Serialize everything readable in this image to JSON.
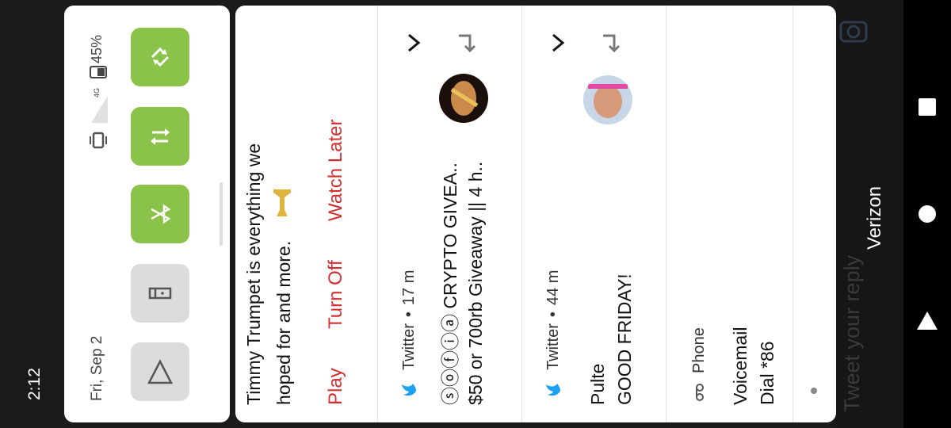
{
  "status_bar": {
    "time": "2:12"
  },
  "quick_settings": {
    "date": "Fri, Sep 2",
    "network": "4G",
    "battery_percent": "45%",
    "tiles": [
      {
        "name": "auto-rotate",
        "state": "on"
      },
      {
        "name": "mobile-data",
        "state": "on"
      },
      {
        "name": "bluetooth",
        "state": "on"
      },
      {
        "name": "flashlight",
        "state": "off"
      },
      {
        "name": "cast",
        "state": "off"
      }
    ],
    "colors": {
      "on": "#8bc34a",
      "off": "#dcdcdc"
    }
  },
  "notifications": {
    "media": {
      "text_line1": "Timmy Trumpet is everything we",
      "text_line2": "hoped for and more.",
      "actions": [
        "Play",
        "Turn Off",
        "Watch Later"
      ]
    },
    "twitter1": {
      "app": "Twitter",
      "time": "17 m",
      "title": "ⓢⓞⓕⓘⓐ CRYPTO GIVEA..",
      "body": "$50 or 700rb Giveaway || 4 h.."
    },
    "twitter2": {
      "app": "Twitter",
      "time": "44 m",
      "title": "Pulte",
      "body": "GOOD FRIDAY!"
    },
    "phone": {
      "app": "Phone",
      "title": "Voicemail",
      "body": "Dial *86"
    }
  },
  "backdrop": {
    "reply_placeholder": "Tweet your reply",
    "carrier": "Verizon"
  },
  "accent_red": "#d32f2f",
  "twitter_blue": "#1da1f2"
}
